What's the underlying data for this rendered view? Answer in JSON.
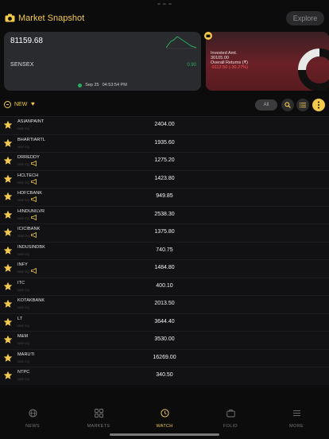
{
  "header": {
    "title": "Market Snapshot",
    "explore_label": "Explore"
  },
  "index_card": {
    "value": "81159.68",
    "name": "SENSEX",
    "change": "0.90",
    "date": "Sep 25",
    "time": "04:53:54 PM"
  },
  "folio_card": {
    "invested_label": "Invested Amt.",
    "invested_value": "30105.00",
    "returns_label": "Overall Returns (₹)",
    "returns_value": "-9112.50 (-30.27%)"
  },
  "filter": {
    "watchlist_label": "NEW",
    "all_label": "All"
  },
  "rows": [
    {
      "symbol": "ASIANPAINT",
      "sub": "NSE EQ",
      "price": "2404.00",
      "ann": false
    },
    {
      "symbol": "BHARTIARTL",
      "sub": "NSE EQ",
      "price": "1935.60",
      "ann": false
    },
    {
      "symbol": "DRREDDY",
      "sub": "NSE EQ",
      "price": "1275.20",
      "ann": true
    },
    {
      "symbol": "HCLTECH",
      "sub": "NSE EQ",
      "price": "1423.80",
      "ann": true
    },
    {
      "symbol": "HDFCBANK",
      "sub": "NSE EQ",
      "price": "949.85",
      "ann": true
    },
    {
      "symbol": "HINDUNILVR",
      "sub": "NSE EQ",
      "price": "2538.30",
      "ann": true
    },
    {
      "symbol": "ICICIBANK",
      "sub": "NSE EQ",
      "price": "1375.80",
      "ann": true
    },
    {
      "symbol": "INDUSINDBK",
      "sub": "NSE EQ",
      "price": "740.75",
      "ann": false
    },
    {
      "symbol": "INFY",
      "sub": "NSE EQ",
      "price": "1484.80",
      "ann": true
    },
    {
      "symbol": "ITC",
      "sub": "NSE EQ",
      "price": "400.10",
      "ann": false
    },
    {
      "symbol": "KOTAKBANK",
      "sub": "NSE EQ",
      "price": "2013.50",
      "ann": false
    },
    {
      "symbol": "LT",
      "sub": "NSE EQ",
      "price": "3644.40",
      "ann": false
    },
    {
      "symbol": "M&M",
      "sub": "NSE EQ",
      "price": "3530.00",
      "ann": false
    },
    {
      "symbol": "MARUTI",
      "sub": "NSE EQ",
      "price": "16269.00",
      "ann": false
    },
    {
      "symbol": "NTPC",
      "sub": "NSE EQ",
      "price": "340.50",
      "ann": false
    }
  ],
  "nav": {
    "news": "NEWS",
    "markets": "MARKETS",
    "watch": "WATCH",
    "folio": "FOLIO",
    "more": "MORE"
  },
  "colors": {
    "accent": "#f2c94c",
    "positive": "#27ae60",
    "negative": "#ff5b5b",
    "folio_bg": "#6a2026"
  }
}
